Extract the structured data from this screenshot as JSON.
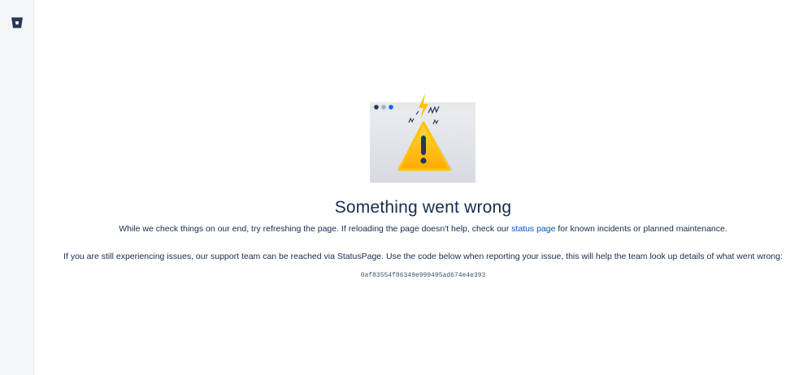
{
  "sidebar": {
    "logo_icon": "bitbucket-logo-icon"
  },
  "error": {
    "title": "Something went wrong",
    "line1_before": "While we check things on our end, try refreshing the page. If reloading the page doesn't help, check our ",
    "status_link": "status page",
    "line1_after": " for known incidents or planned maintenance.",
    "line2": "If you are still experiencing issues, our support team can be reached via StatusPage. Use the code below when reporting your issue, this will help the team look up details of what went wrong:",
    "code": "0af83554f86349e999495ad674e4e393"
  },
  "colors": {
    "sidebar_bg": "#f4f5f7",
    "text": "#172b4d",
    "link": "#0052cc",
    "warning": "#ffc400"
  }
}
